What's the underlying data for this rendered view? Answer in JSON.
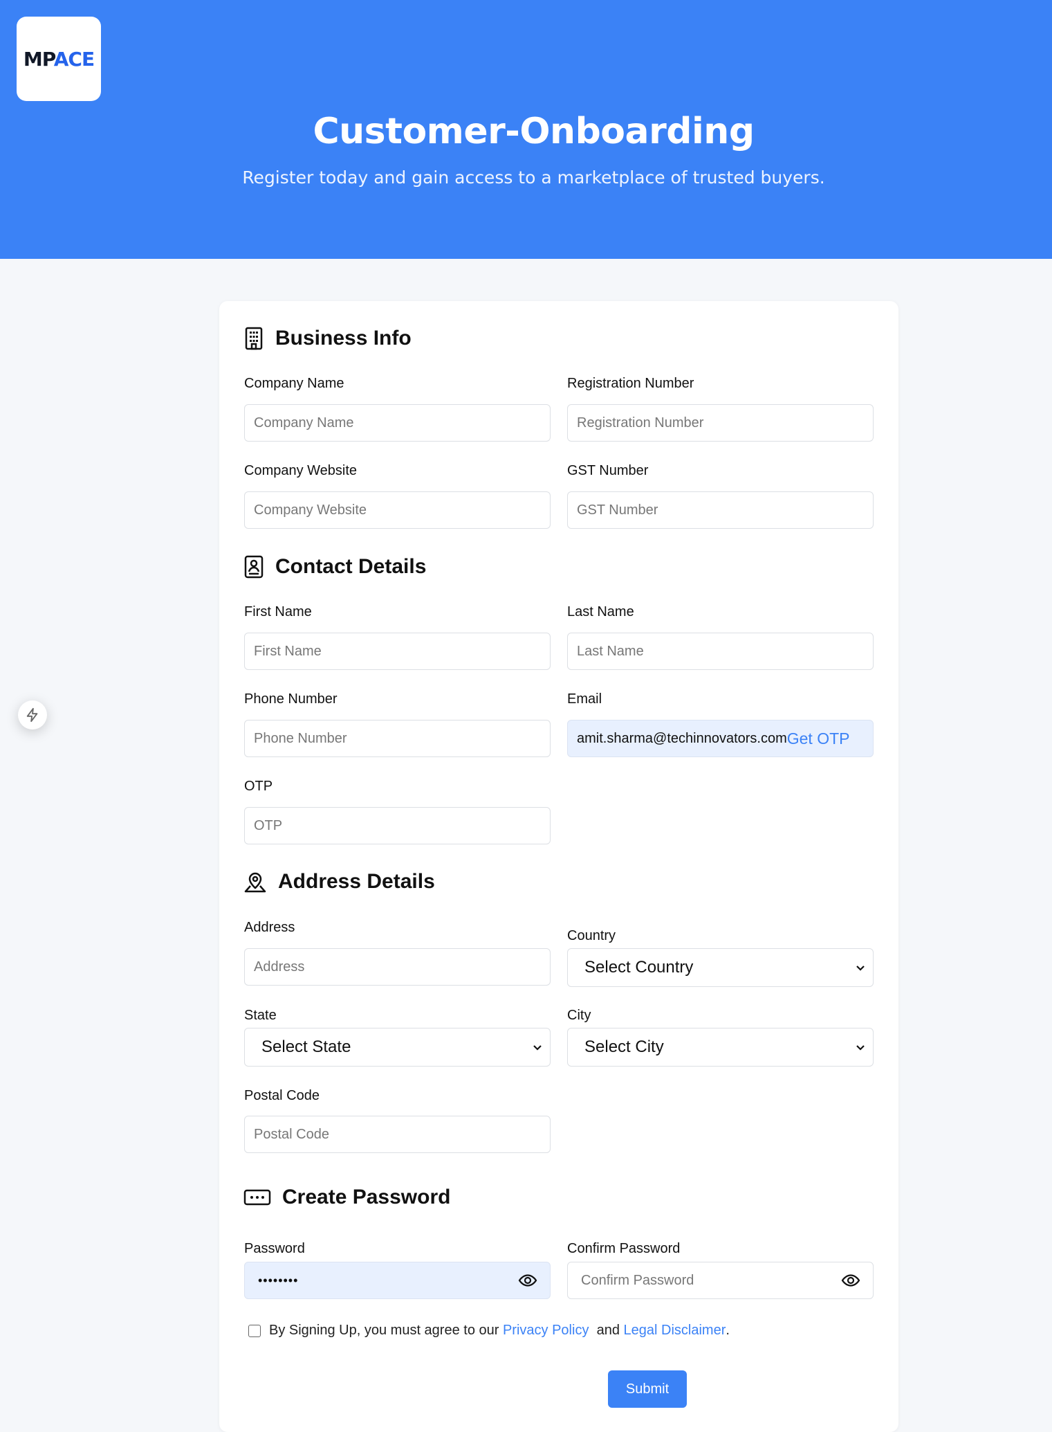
{
  "logo": {
    "part1": "MP",
    "part2": "ACE"
  },
  "hero": {
    "title": "Customer-Onboarding",
    "subtitle": "Register today and gain access to a marketplace of trusted buyers."
  },
  "sections": {
    "business": {
      "title": "Business Info",
      "company_name": {
        "label": "Company Name",
        "placeholder": "Company Name"
      },
      "registration_number": {
        "label": "Registration Number",
        "placeholder": "Registration Number"
      },
      "company_website": {
        "label": "Company Website",
        "placeholder": "Company Website"
      },
      "gst_number": {
        "label": "GST Number",
        "placeholder": "GST Number"
      }
    },
    "contact": {
      "title": "Contact Details",
      "first_name": {
        "label": "First Name",
        "placeholder": "First Name"
      },
      "last_name": {
        "label": "Last Name",
        "placeholder": "Last Name"
      },
      "phone": {
        "label": "Phone Number",
        "placeholder": "Phone Number"
      },
      "email": {
        "label": "Email",
        "value": "amit.sharma@techinnovators.com",
        "action": "Get OTP"
      },
      "otp": {
        "label": "OTP",
        "placeholder": "OTP"
      }
    },
    "address": {
      "title": "Address Details",
      "address": {
        "label": "Address",
        "placeholder": "Address"
      },
      "country": {
        "label": "Country",
        "selected": "Select Country"
      },
      "state": {
        "label": "State",
        "selected": "Select State"
      },
      "city": {
        "label": "City",
        "selected": "Select City"
      },
      "postal_code": {
        "label": "Postal Code",
        "placeholder": "Postal Code"
      }
    },
    "password": {
      "title": "Create Password",
      "password": {
        "label": "Password",
        "value": "••••••••"
      },
      "confirm": {
        "label": "Confirm Password",
        "placeholder": "Confirm Password"
      }
    }
  },
  "agreement": {
    "prefix": "By Signing Up, you must agree to our",
    "privacy": "Privacy Policy",
    "and": "and",
    "disclaimer": "Legal Disclaimer",
    "suffix": "."
  },
  "submit_label": "Submit",
  "icons": {
    "business": "building-icon",
    "contact": "contact-card-icon",
    "address": "map-pin-icon",
    "password": "password-dots-icon",
    "side": "lightning-icon",
    "eye": "eye-icon",
    "chevron": "chevron-down-icon"
  },
  "colors": {
    "brand": "#3b82f6",
    "autofill": "#e8f0fe"
  }
}
